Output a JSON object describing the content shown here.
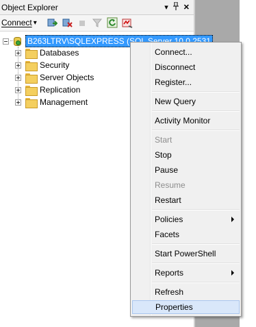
{
  "panel": {
    "title": "Object Explorer",
    "pin_glyph": "▾ ✚",
    "close_glyph": "✕"
  },
  "toolbar": {
    "connect_label": "Connect",
    "connect_arrow": "▾"
  },
  "tree": {
    "server_label": "B263LTRV\\SQLEXPRESS (SQL Server 10.0.2531",
    "children": [
      {
        "label": "Databases"
      },
      {
        "label": "Security"
      },
      {
        "label": "Server Objects"
      },
      {
        "label": "Replication"
      },
      {
        "label": "Management"
      }
    ]
  },
  "context_menu": {
    "items": [
      {
        "label": "Connect...",
        "enabled": true
      },
      {
        "label": "Disconnect",
        "enabled": true
      },
      {
        "label": "Register...",
        "enabled": true
      },
      {
        "label": "New Query",
        "enabled": true
      },
      {
        "label": "Activity Monitor",
        "enabled": true
      },
      {
        "label": "Start",
        "enabled": false
      },
      {
        "label": "Stop",
        "enabled": true
      },
      {
        "label": "Pause",
        "enabled": true
      },
      {
        "label": "Resume",
        "enabled": false
      },
      {
        "label": "Restart",
        "enabled": true
      },
      {
        "label": "Policies",
        "enabled": true,
        "submenu": true
      },
      {
        "label": "Facets",
        "enabled": true
      },
      {
        "label": "Start PowerShell",
        "enabled": true
      },
      {
        "label": "Reports",
        "enabled": true,
        "submenu": true
      },
      {
        "label": "Refresh",
        "enabled": true
      },
      {
        "label": "Properties",
        "enabled": true,
        "selected": true
      }
    ]
  },
  "colors": {
    "selection": "#3399ff",
    "menu_highlight": "#d9e7fa",
    "gray_background": "#a9a9a9"
  }
}
